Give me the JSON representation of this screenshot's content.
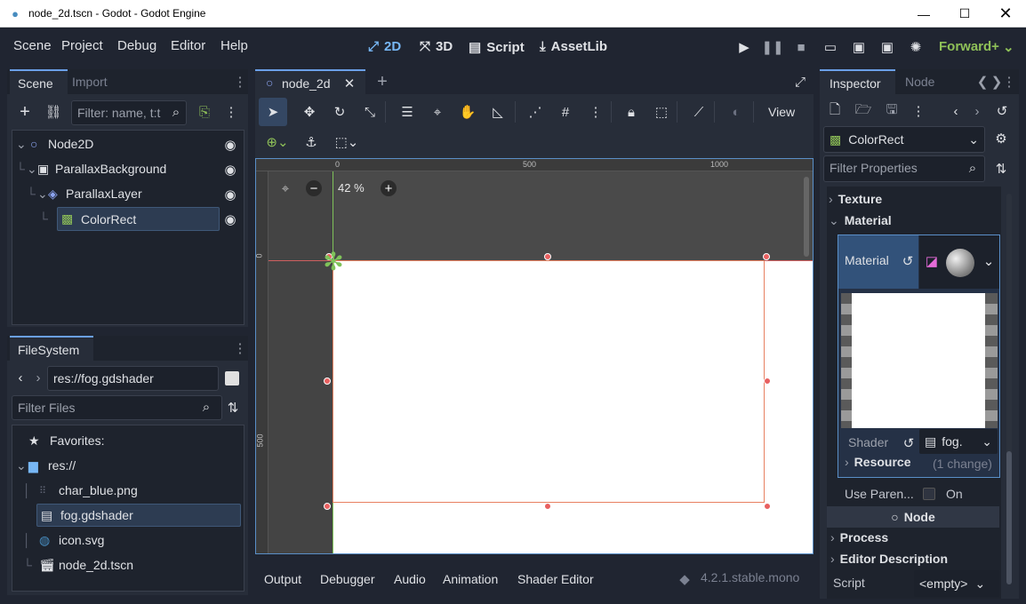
{
  "window": {
    "title": "node_2d.tscn - Godot - Godot Engine"
  },
  "menu": {
    "items": [
      "Scene",
      "Project",
      "Debug",
      "Editor",
      "Help"
    ]
  },
  "modes": {
    "d2": "2D",
    "d3": "3D",
    "script": "Script",
    "assetlib": "AssetLib"
  },
  "renderer": "Forward+",
  "scene_dock": {
    "tab_scene": "Scene",
    "tab_import": "Import",
    "filter_placeholder": "Filter: name, t:t",
    "nodes": [
      {
        "name": "Node2D"
      },
      {
        "name": "ParallaxBackground"
      },
      {
        "name": "ParallaxLayer"
      },
      {
        "name": "ColorRect"
      }
    ]
  },
  "filesystem": {
    "title": "FileSystem",
    "path": "res://fog.gdshader",
    "filter_placeholder": "Filter Files",
    "favorites": "Favorites:",
    "root": "res://",
    "files": [
      "char_blue.png",
      "fog.gdshader",
      "icon.svg",
      "node_2d.tscn"
    ]
  },
  "viewport": {
    "tab": "node_2d",
    "view_button": "View",
    "zoom": "42 %",
    "ruler_h": [
      "0",
      "500",
      "1000"
    ],
    "ruler_v": [
      "0",
      "500"
    ]
  },
  "bottom_panel": {
    "tabs": [
      "Output",
      "Debugger",
      "Audio",
      "Animation",
      "Shader Editor"
    ],
    "version": "4.2.1.stable.mono"
  },
  "inspector": {
    "tab_inspector": "Inspector",
    "tab_node": "Node",
    "object_name": "ColorRect",
    "filter_placeholder": "Filter Properties",
    "section_texture": "Texture",
    "section_material": "Material",
    "material_label": "Material",
    "shader_label": "Shader",
    "shader_value": "fog.",
    "resource_label": "Resource",
    "resource_value": "(1 change)",
    "use_parent_label": "Use Paren...",
    "use_parent_value": "On",
    "node_header": "Node",
    "process_label": "Process",
    "editor_desc_label": "Editor Description",
    "script_label": "Script",
    "script_value": "<empty>"
  },
  "colors": {
    "accent": "#77b7f5",
    "renderer": "#8fc158",
    "selection_outline": "#e86060"
  }
}
